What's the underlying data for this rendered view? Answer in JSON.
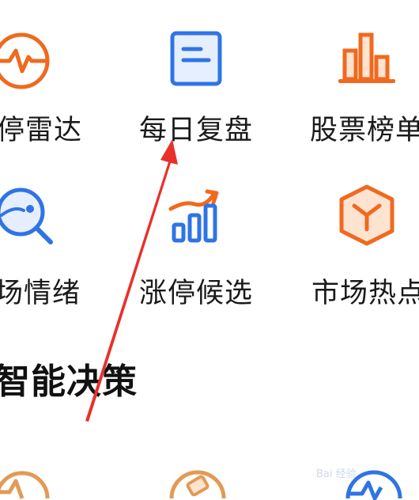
{
  "menu_row_1": [
    {
      "label": "停雷达",
      "icon": "radar-icon"
    },
    {
      "label": "每日复盘",
      "icon": "document-icon"
    },
    {
      "label": "股票榜单",
      "icon": "bar-chart-icon"
    }
  ],
  "menu_row_2": [
    {
      "label": "场情绪",
      "icon": "magnifier-icon"
    },
    {
      "label": "涨停候选",
      "icon": "growth-chart-icon"
    },
    {
      "label": "市场热点",
      "icon": "cube-icon"
    }
  ],
  "section": {
    "title": "智能决策"
  },
  "watermark": {
    "text": "Bai 经验"
  },
  "colors": {
    "orange": "#ef6a1f",
    "blue": "#2f74e6",
    "arrow_red": "#e8312a"
  }
}
